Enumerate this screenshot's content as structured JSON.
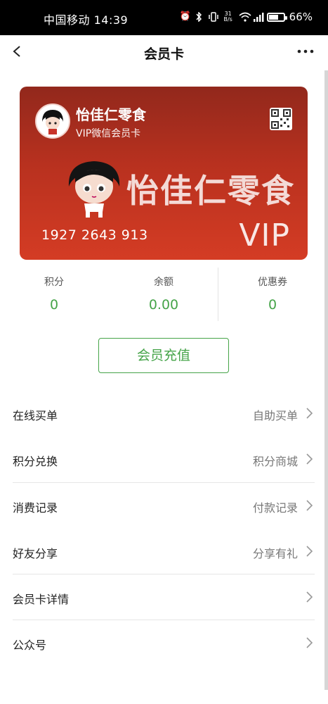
{
  "status_bar": {
    "carrier_time": "中国移动 14:39",
    "speed_top": "31",
    "speed_bottom": "B/s",
    "battery_percent": "66%",
    "battery_level": 0.66,
    "icons": [
      "alarm-icon",
      "bluetooth-icon",
      "vibrate-icon",
      "wifi-icon",
      "signal-icon",
      "battery-icon"
    ]
  },
  "nav": {
    "title": "会员卡",
    "back_icon": "chevron-left-icon",
    "more_icon": "more-dots-icon"
  },
  "card": {
    "brand": "怡佳仁零食",
    "type": "VIP微信会员卡",
    "wordmark": "怡佳仁零食",
    "number": "1927 2643 913",
    "vip": "VIP",
    "qr_icon": "qr-code-icon",
    "colors": {
      "top": "#92281c",
      "bottom": "#d43c24"
    }
  },
  "stats": [
    {
      "label": "积分",
      "value": "0"
    },
    {
      "label": "余额",
      "value": "0.00"
    },
    {
      "label": "优惠券",
      "value": "0"
    }
  ],
  "recharge_button": "会员充值",
  "accent_color": "#46a449",
  "menu": [
    {
      "label": "在线买单",
      "value": "自助买单"
    },
    {
      "label": "积分兑换",
      "value": "积分商城"
    },
    {
      "label": "消费记录",
      "value": "付款记录"
    },
    {
      "label": "好友分享",
      "value": "分享有礼"
    },
    {
      "label": "会员卡详情",
      "value": ""
    },
    {
      "label": "公众号",
      "value": ""
    }
  ]
}
